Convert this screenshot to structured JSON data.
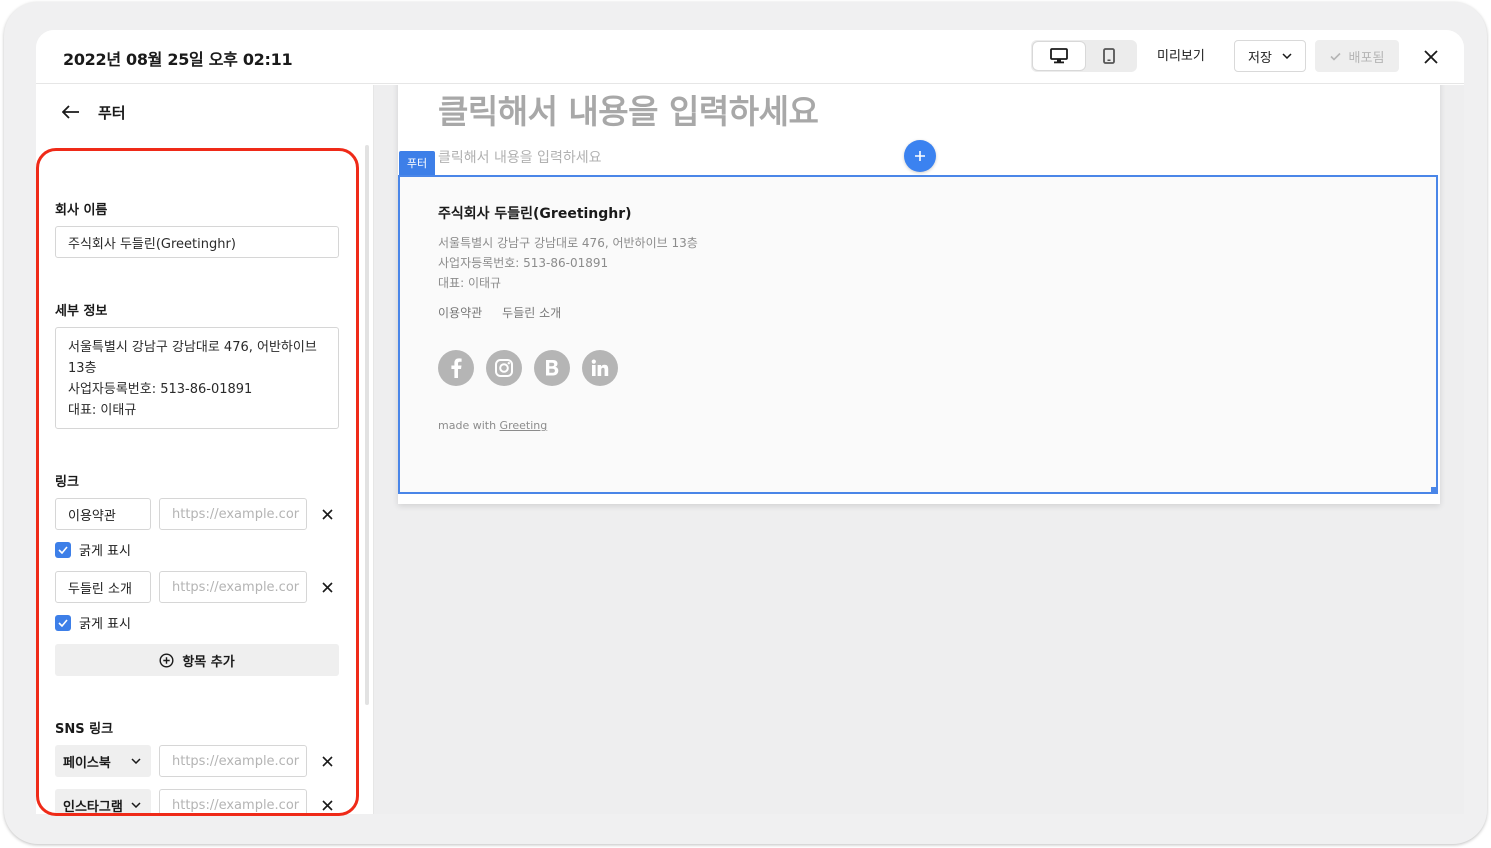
{
  "header": {
    "title": "2022년 08월 25일 오후 02:11",
    "preview_label": "미리보기",
    "save_label": "저장",
    "deploy_label": "배포됨"
  },
  "sidebar": {
    "back_title": "푸터",
    "company_name": {
      "label": "회사 이름",
      "value": "주식회사 두들린(Greetinghr)"
    },
    "details": {
      "label": "세부 정보",
      "lines": [
        "서울특별시 강남구 강남대로 476, 어반하이브",
        "13층",
        "사업자등록번호: 513-86-01891",
        "대표: 이태규"
      ]
    },
    "links": {
      "label": "링크",
      "items": [
        {
          "name": "이용약관",
          "url_placeholder": "https://example.cor",
          "bold_label": "굵게 표시"
        },
        {
          "name": "두들린 소개",
          "url_placeholder": "https://example.cor",
          "bold_label": "굵게 표시"
        }
      ],
      "add_label": "항목 추가"
    },
    "sns": {
      "label": "SNS 링크",
      "items": [
        {
          "platform": "페이스북",
          "url_placeholder": "https://example.cor"
        },
        {
          "platform": "인스타그램",
          "url_placeholder": "https://example.cor"
        }
      ]
    }
  },
  "canvas": {
    "heading_placeholder": "클릭해서 내용을 입력하세요",
    "body_placeholder": "클릭해서 내용을 입력하세요",
    "footer_tag": "푸터",
    "footer": {
      "company": "주식회사 두들린(Greetinghr)",
      "detail_lines": [
        "서울특별시 강남구 강남대로 476, 어반하이브 13층",
        "사업자등록번호: 513-86-01891",
        "대표: 이태규"
      ],
      "links": [
        "이용약관",
        "두들린 소개"
      ],
      "sns_icons": [
        "facebook-icon",
        "instagram-icon",
        "blog-icon",
        "linkedin-icon"
      ],
      "made_with_prefix": "made with",
      "made_with_link": "Greeting"
    }
  },
  "colors": {
    "accent": "#3d7fe8",
    "highlight": "#ef2a18",
    "canvas_bg": "#eeeeef"
  }
}
